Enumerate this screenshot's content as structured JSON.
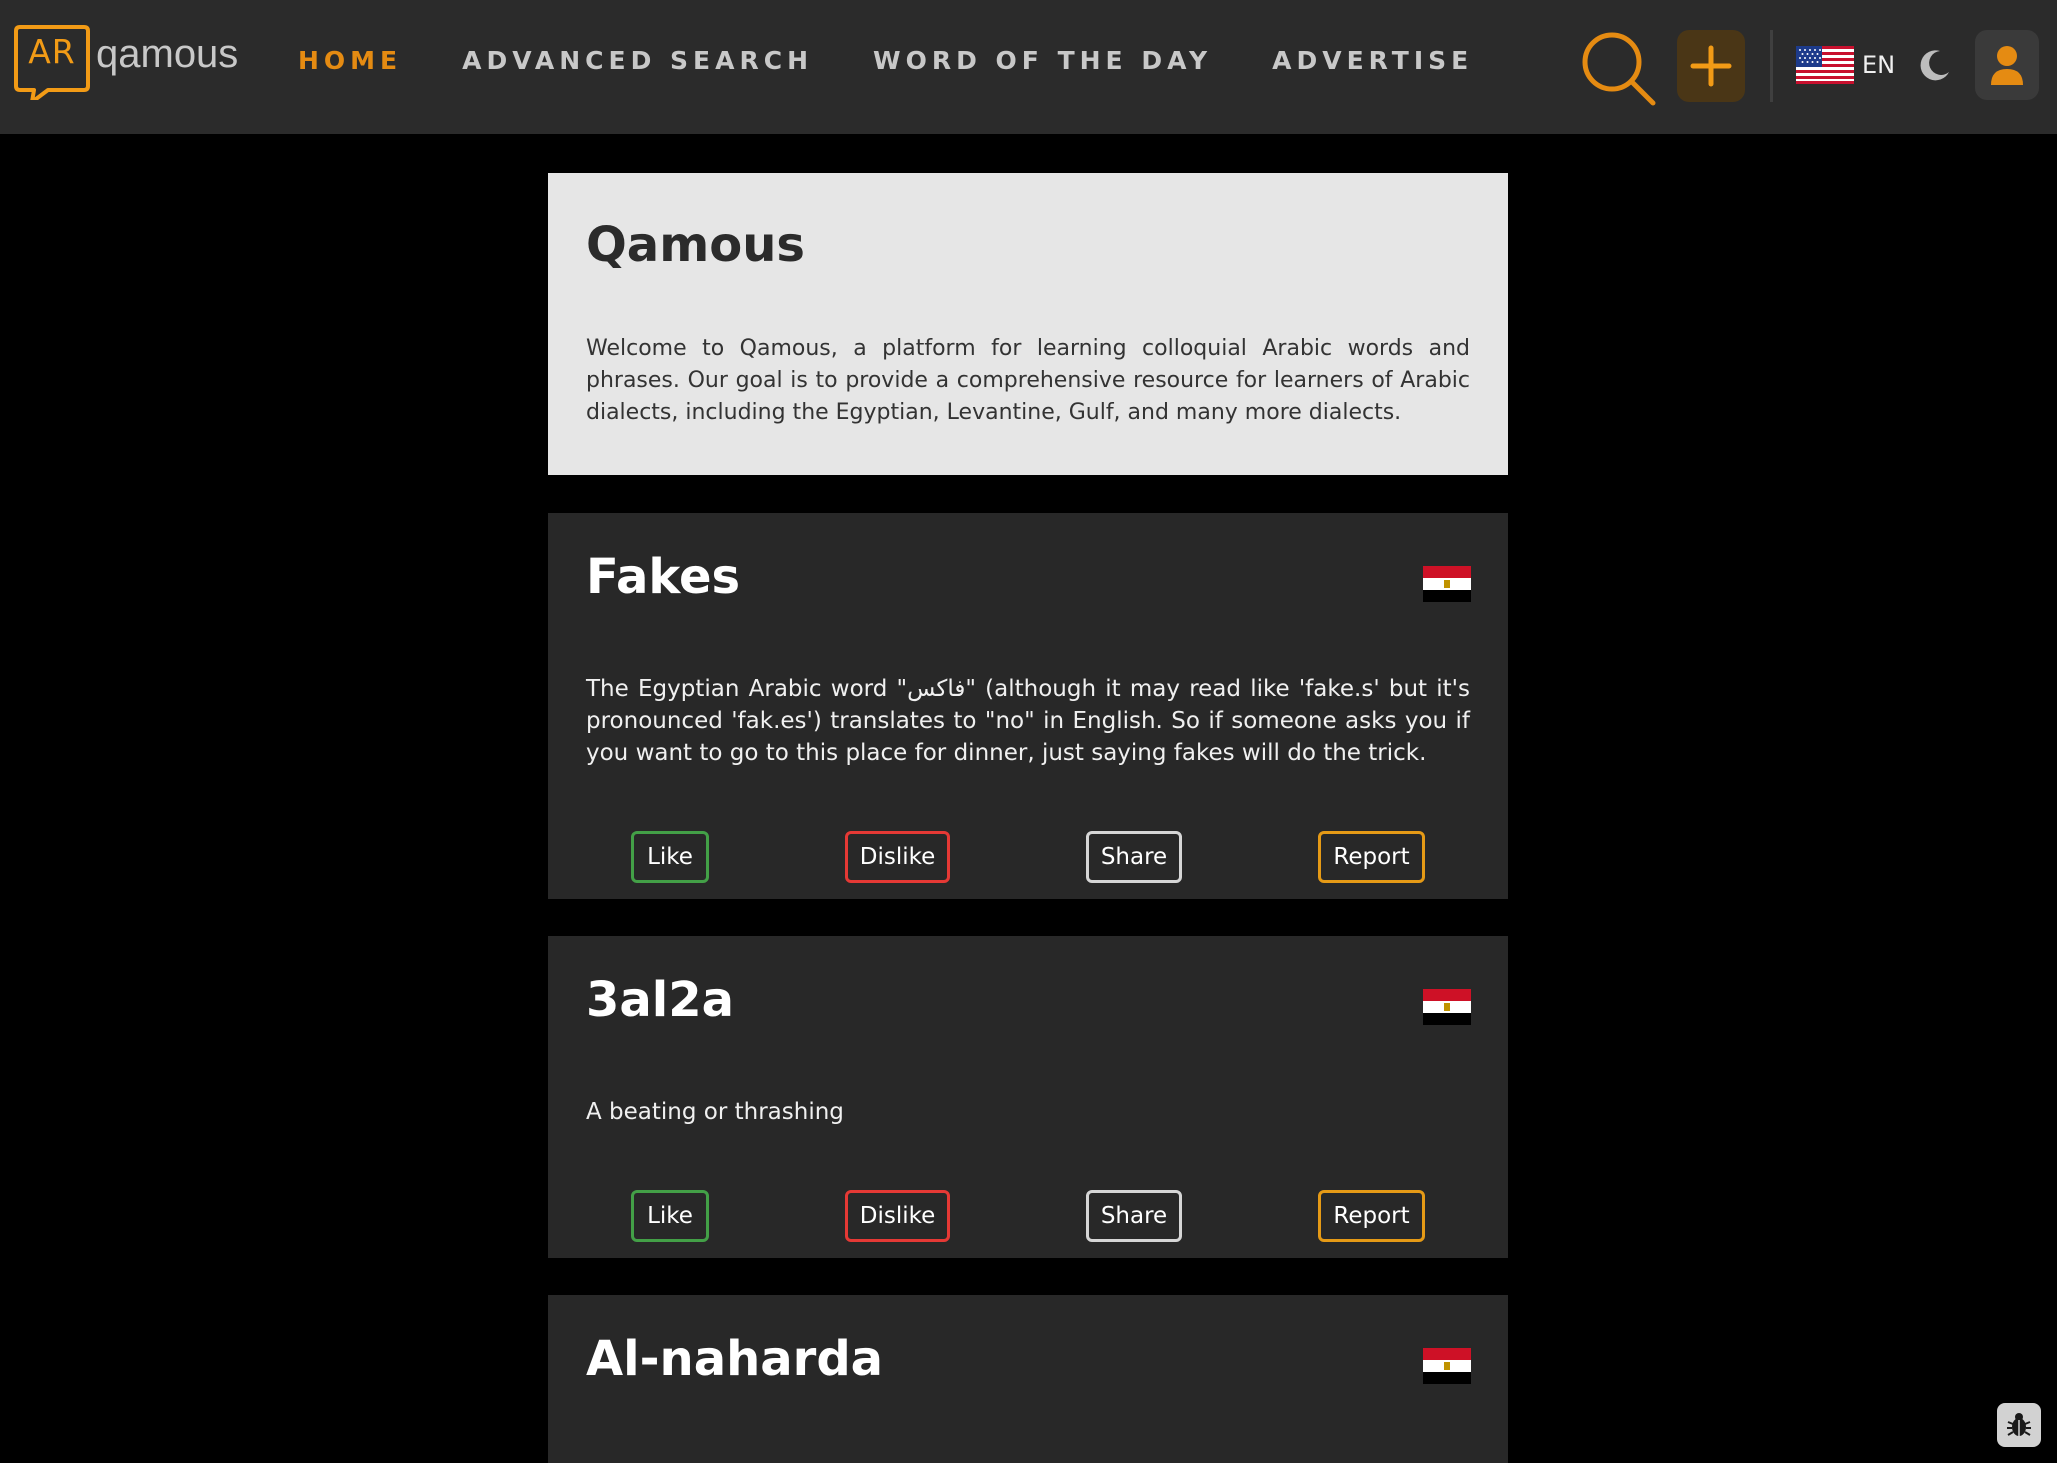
{
  "header": {
    "logo_badge": "AR",
    "logo_word": "qamous",
    "nav": [
      {
        "label": "HOME",
        "active": true
      },
      {
        "label": "ADVANCED SEARCH",
        "active": false
      },
      {
        "label": "WORD OF THE DAY",
        "active": false
      },
      {
        "label": "ADVERTISE",
        "active": false
      }
    ],
    "language": "EN",
    "icons": {
      "search": "search-icon",
      "add": "plus-icon",
      "language_flag": "us-flag-icon",
      "theme": "moon-icon",
      "user": "user-icon"
    }
  },
  "colors": {
    "accent": "#e58b12",
    "navbar_bg": "#2b2b2b",
    "page_bg": "#000000",
    "card_bg": "#282828",
    "intro_bg": "#e6e6e6",
    "like": "#43a047",
    "dislike": "#e53935",
    "share": "#d6d6d6",
    "report": "#e59a16"
  },
  "intro": {
    "title": "Qamous",
    "text": "Welcome to Qamous, a platform for learning colloquial Arabic words and phrases. Our goal is to provide a comprehensive resource for learners of Arabic dialects, including the Egyptian, Levantine, Gulf, and many more dialects."
  },
  "actions": {
    "like": "Like",
    "dislike": "Dislike",
    "share": "Share",
    "report": "Report"
  },
  "entries": [
    {
      "title": "Fakes",
      "flag": "egypt-flag-icon",
      "text": "The Egyptian Arabic word \"فاكس\" (although it may read like 'fake.s' but it's pronounced 'fak.es') translates to \"no\" in English. So if someone asks you if you want to go to this place for dinner, just saying fakes will do the trick."
    },
    {
      "title": "3al2a",
      "flag": "egypt-flag-icon",
      "text": "A beating or thrashing"
    },
    {
      "title": "Al-naharda",
      "flag": "egypt-flag-icon",
      "text": ""
    }
  ],
  "floating": {
    "bug_report": "bug-icon"
  }
}
